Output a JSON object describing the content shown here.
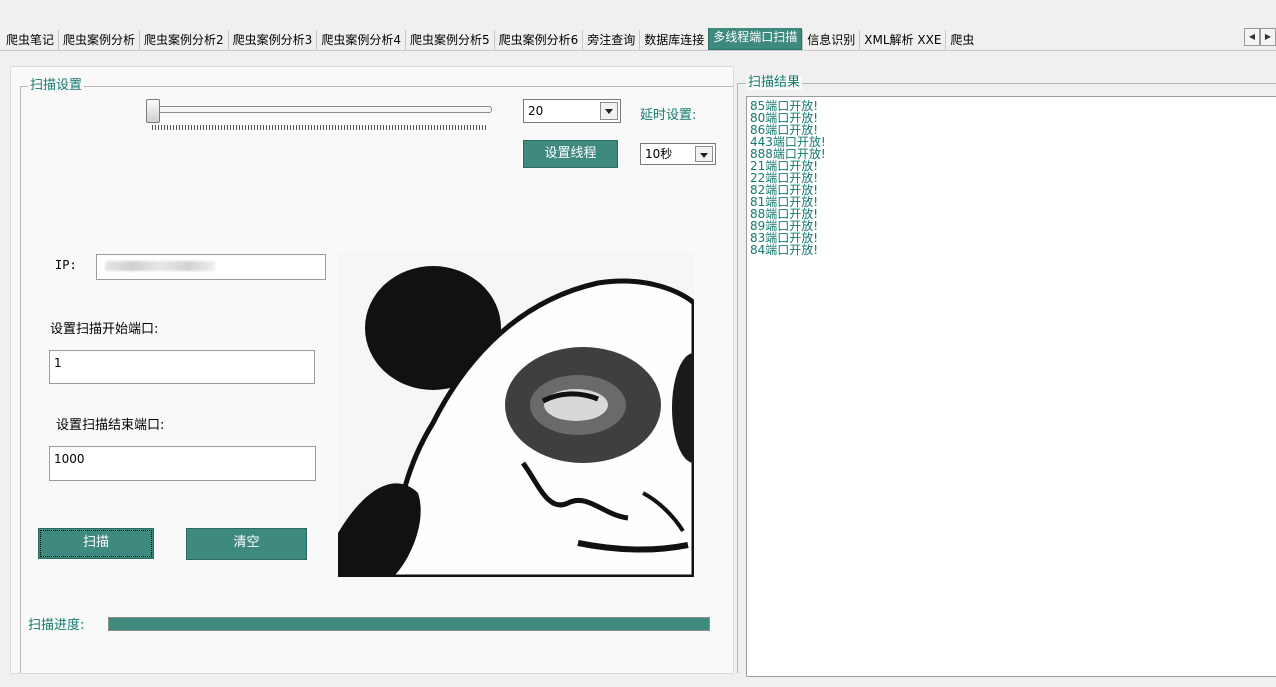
{
  "tabs": [
    {
      "label": "爬虫笔记",
      "active": false
    },
    {
      "label": "爬虫案例分析",
      "active": false
    },
    {
      "label": "爬虫案例分析2",
      "active": false
    },
    {
      "label": "爬虫案例分析3",
      "active": false
    },
    {
      "label": "爬虫案例分析4",
      "active": false
    },
    {
      "label": "爬虫案例分析5",
      "active": false
    },
    {
      "label": "爬虫案例分析6",
      "active": false
    },
    {
      "label": "旁注查询",
      "active": false
    },
    {
      "label": "数据库连接",
      "active": false
    },
    {
      "label": "多线程端口扫描",
      "active": true
    },
    {
      "label": "信息识别",
      "active": false
    },
    {
      "label": "XML解析 XXE",
      "active": false
    },
    {
      "label": "爬虫",
      "active": false
    }
  ],
  "scan_settings": {
    "title": "扫描设置",
    "thread_count": "20",
    "delay_label": "延时设置:",
    "delay_value": "10秒",
    "set_threads_button": "设置线程",
    "ip_label": "IP:",
    "ip_value": "",
    "start_port_label": "设置扫描开始端口:",
    "start_port_value": "1",
    "end_port_label": "设置扫描结束端口:",
    "end_port_value": "1000",
    "scan_button": "扫描",
    "clear_button": "清空",
    "progress_label": "扫描进度:",
    "progress_value": 1.0
  },
  "results": {
    "title": "扫描结果",
    "lines": [
      "85端口开放!",
      "80端口开放!",
      "86端口开放!",
      "443端口开放!",
      "888端口开放!",
      "21端口开放!",
      "22端口开放!",
      "82端口开放!",
      "81端口开放!",
      "88端口开放!",
      "89端口开放!",
      "83端口开放!",
      "84端口开放!"
    ]
  },
  "colors": {
    "accent": "#3f8a7f",
    "label_teal": "#137a6e"
  },
  "icons": {
    "scroll_left": "triangle-left",
    "scroll_right": "triangle-right"
  }
}
